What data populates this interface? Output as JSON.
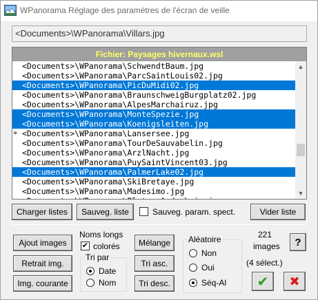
{
  "window": {
    "title": "WPanorama  Réglage des paramètres de l'écran de veille"
  },
  "path_field": {
    "value": "<Documents>\\WPanorama\\Villars.jpg"
  },
  "list": {
    "header": "Fichier:  Paysages hivernaux.wsl",
    "items": [
      {
        "text": "<Documents>\\WPanorama\\SchwendtBaum.jpg",
        "selected": false
      },
      {
        "text": "<Documents>\\WPanorama\\ParcSaintLouis02.jpg",
        "selected": false
      },
      {
        "text": "<Documents>\\WPanorama\\PicDuMidi02.jpg",
        "selected": true
      },
      {
        "text": "<Documents>\\WPanorama\\BraunschweigBurgplatz02.jpg",
        "selected": false
      },
      {
        "text": "<Documents>\\WPanorama\\AlpesMarchairuz.jpg",
        "selected": false
      },
      {
        "text": "<Documents>\\WPanorama\\MonteSpezie.jpg",
        "selected": true
      },
      {
        "text": "<Documents>\\WPanorama\\Koenigsleiten.jpg",
        "selected": true
      },
      {
        "text": "<Documents>\\WPanorama\\Lansersee.jpg",
        "selected": false
      },
      {
        "text": "<Documents>\\WPanorama\\TourDeSauvabelin.jpg",
        "selected": false
      },
      {
        "text": "<Documents>\\WPanorama\\ArzlNacht.jpg",
        "selected": false
      },
      {
        "text": "<Documents>\\WPanorama\\PuySaintVincent03.jpg",
        "selected": false
      },
      {
        "text": "<Documents>\\WPanorama\\PalmerLake02.jpg",
        "selected": true
      },
      {
        "text": "<Documents>\\WPanorama\\SkiBretaye.jpg",
        "selected": false
      },
      {
        "text": "<Documents>\\WPanorama\\Madesimo.jpg",
        "selected": false
      },
      {
        "text": "<Documents>\\WPanorama\\PlateauArdechois.jpg",
        "selected": false
      }
    ],
    "current_item_marker": "»",
    "current_item_index": 7
  },
  "row1": {
    "charger": "Charger listes",
    "sauveg": "Sauveg. liste",
    "sauveg_param": "Sauveg. param. spect.",
    "sauveg_param_checked": false,
    "vider": "Vider liste"
  },
  "left_buttons": {
    "ajout": "Ajout images",
    "retrait": "Retrait img.",
    "courante": "Img. courante"
  },
  "noms_longs": {
    "line1": "Noms longs",
    "line2": "colorés",
    "checked": true,
    "check_glyph": "✔"
  },
  "tri_par": {
    "legend": "Tri par",
    "opt_date": "Date",
    "opt_nom": "Nom",
    "selected": "Date"
  },
  "mid_buttons": {
    "melange": "Mélange",
    "tri_asc": "Tri asc.",
    "tri_desc": "Tri desc."
  },
  "aleatoire": {
    "legend": "Aléatoire",
    "opt_non": "Non",
    "opt_oui": "Oui",
    "opt_seq": "Séq-Al",
    "selected": "Séq-Al"
  },
  "counts": {
    "images_count": "221",
    "images_label": "images",
    "selected_label": "(4 sélect.)"
  },
  "help": {
    "label": "?"
  },
  "ok": {
    "glyph": "✔"
  },
  "cancel": {
    "glyph": "✖"
  },
  "colors": {
    "selection": "#0078d7",
    "header_bg": "#a0a0a0",
    "header_text": "#ffff66",
    "ok_green": "#1e9e1e",
    "cancel_red": "#d81e1e"
  },
  "icons": {
    "app": "panorama-app-icon",
    "scroll_up": "scroll-up-arrow-icon",
    "scroll_down": "scroll-down-arrow-icon",
    "help": "help-question-icon",
    "ok": "checkmark-icon",
    "cancel": "cross-icon"
  }
}
